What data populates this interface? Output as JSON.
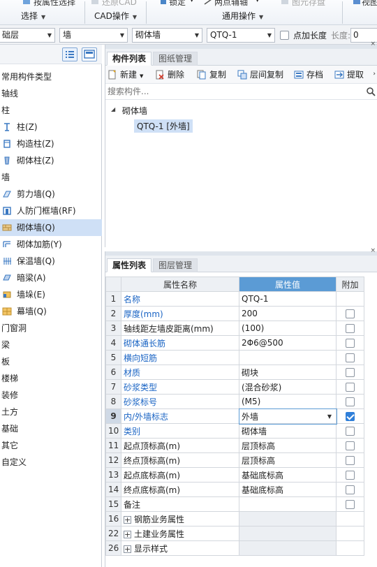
{
  "ribbon": {
    "top_labels": [
      "按属性选择",
      "还原CAD",
      "锁定",
      "两点辅轴",
      "图元存盘",
      "视图"
    ],
    "groups": [
      "选择",
      "CAD操作",
      "通用操作"
    ]
  },
  "filter": {
    "floor": "础层",
    "type": "墙",
    "subtype": "砌体墙",
    "component": "QTQ-1",
    "point_length_label": "点加长度",
    "length_label": "长度:",
    "length_value": "0"
  },
  "left_tree": {
    "items": [
      {
        "label": "常用构件类型",
        "kind": "cat",
        "icon": ""
      },
      {
        "label": "轴线",
        "kind": "cat",
        "icon": ""
      },
      {
        "label": "柱",
        "kind": "cat",
        "icon": ""
      },
      {
        "label": "柱(Z)",
        "kind": "sub",
        "icon": "column-icon"
      },
      {
        "label": "构造柱(Z)",
        "kind": "sub",
        "icon": "structural-column-icon"
      },
      {
        "label": "砌体柱(Z)",
        "kind": "sub",
        "icon": "masonry-column-icon"
      },
      {
        "label": "墙",
        "kind": "cat",
        "icon": ""
      },
      {
        "label": "剪力墙(Q)",
        "kind": "sub",
        "icon": "shear-wall-icon"
      },
      {
        "label": "人防门框墙(RF)",
        "kind": "sub",
        "icon": "civil-defense-wall-icon"
      },
      {
        "label": "砌体墙(Q)",
        "kind": "sub",
        "icon": "masonry-wall-icon",
        "selected": true
      },
      {
        "label": "砌体加筋(Y)",
        "kind": "sub",
        "icon": "masonry-rebar-icon"
      },
      {
        "label": "保温墙(Q)",
        "kind": "sub",
        "icon": "insulation-wall-icon"
      },
      {
        "label": "暗梁(A)",
        "kind": "sub",
        "icon": "hidden-beam-icon"
      },
      {
        "label": "墙垛(E)",
        "kind": "sub",
        "icon": "wall-pier-icon"
      },
      {
        "label": "幕墙(Q)",
        "kind": "sub",
        "icon": "curtain-wall-icon"
      },
      {
        "label": "门窗洞",
        "kind": "cat",
        "icon": ""
      },
      {
        "label": "梁",
        "kind": "cat",
        "icon": ""
      },
      {
        "label": "板",
        "kind": "cat",
        "icon": ""
      },
      {
        "label": "楼梯",
        "kind": "cat",
        "icon": ""
      },
      {
        "label": "装修",
        "kind": "cat",
        "icon": ""
      },
      {
        "label": "土方",
        "kind": "cat",
        "icon": ""
      },
      {
        "label": "基础",
        "kind": "cat",
        "icon": ""
      },
      {
        "label": "其它",
        "kind": "cat",
        "icon": ""
      },
      {
        "label": "自定义",
        "kind": "cat",
        "icon": ""
      }
    ]
  },
  "component_panel": {
    "tabs": [
      "构件列表",
      "图纸管理"
    ],
    "toolbar": {
      "new": "新建",
      "delete": "删除",
      "copy": "复制",
      "floor_copy": "层间复制",
      "save": "存档",
      "extract": "提取"
    },
    "search_placeholder": "搜索构件...",
    "tree_root": "砌体墙",
    "tree_child": "QTQ-1 [外墙]"
  },
  "property_panel": {
    "tabs": [
      "属性列表",
      "图层管理"
    ],
    "headers": [
      "属性名称",
      "属性值",
      "附加"
    ],
    "rows": [
      {
        "num": "1",
        "name": "名称",
        "value": "QTQ-1",
        "blue": true,
        "check": false
      },
      {
        "num": "2",
        "name": "厚度(mm)",
        "value": "200",
        "blue": true,
        "check": true
      },
      {
        "num": "3",
        "name": "轴线距左墙皮距离(mm)",
        "value": "(100)",
        "blue": false,
        "check": true
      },
      {
        "num": "4",
        "name": "砌体通长筋",
        "value": "2Φ6@500",
        "blue": true,
        "check": true
      },
      {
        "num": "5",
        "name": "横向短筋",
        "value": "",
        "blue": true,
        "check": true
      },
      {
        "num": "6",
        "name": "材质",
        "value": "砌块",
        "blue": true,
        "check": true
      },
      {
        "num": "7",
        "name": "砂浆类型",
        "value": "(混合砂浆)",
        "blue": true,
        "check": true
      },
      {
        "num": "8",
        "name": "砂浆标号",
        "value": "(M5)",
        "blue": true,
        "check": true
      },
      {
        "num": "9",
        "name": "内/外墙标志",
        "value": "外墙",
        "blue": true,
        "check": true,
        "checked": true,
        "current": true
      },
      {
        "num": "10",
        "name": "类别",
        "value": "砌体墙",
        "blue": true,
        "check": true
      },
      {
        "num": "11",
        "name": "起点顶标高(m)",
        "value": "层顶标高",
        "blue": false,
        "check": true
      },
      {
        "num": "12",
        "name": "终点顶标高(m)",
        "value": "层顶标高",
        "blue": false,
        "check": true
      },
      {
        "num": "13",
        "name": "起点底标高(m)",
        "value": "基础底标高",
        "blue": false,
        "check": true
      },
      {
        "num": "14",
        "name": "终点底标高(m)",
        "value": "基础底标高",
        "blue": false,
        "check": true
      },
      {
        "num": "15",
        "name": "备注",
        "value": "",
        "blue": false,
        "check": true
      }
    ],
    "group_rows": [
      {
        "num": "16",
        "name": "钢筋业务属性"
      },
      {
        "num": "22",
        "name": "土建业务属性"
      },
      {
        "num": "26",
        "name": "显示样式"
      }
    ]
  }
}
